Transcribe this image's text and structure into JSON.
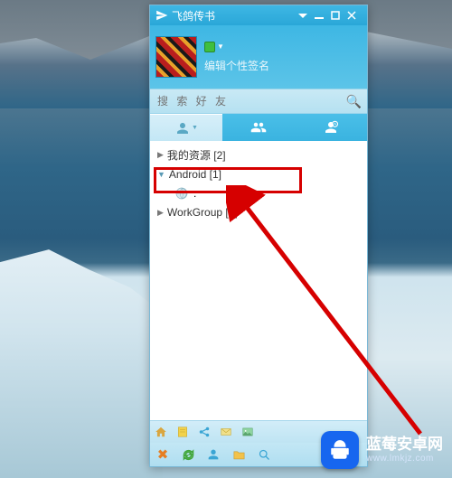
{
  "app": {
    "title": "飞鸽传书",
    "signature": "编辑个性签名",
    "search_placeholder": "搜 索 好 友"
  },
  "groups": {
    "g0": {
      "label": "我的资源 [2]"
    },
    "g1": {
      "label": "Android [1]"
    },
    "g1_contact": {
      "label": ":"
    },
    "g2": {
      "label": "WorkGroup [1]"
    }
  },
  "watermark": {
    "line1": "蓝莓安卓网",
    "line2": "www.lmkjz.com"
  }
}
